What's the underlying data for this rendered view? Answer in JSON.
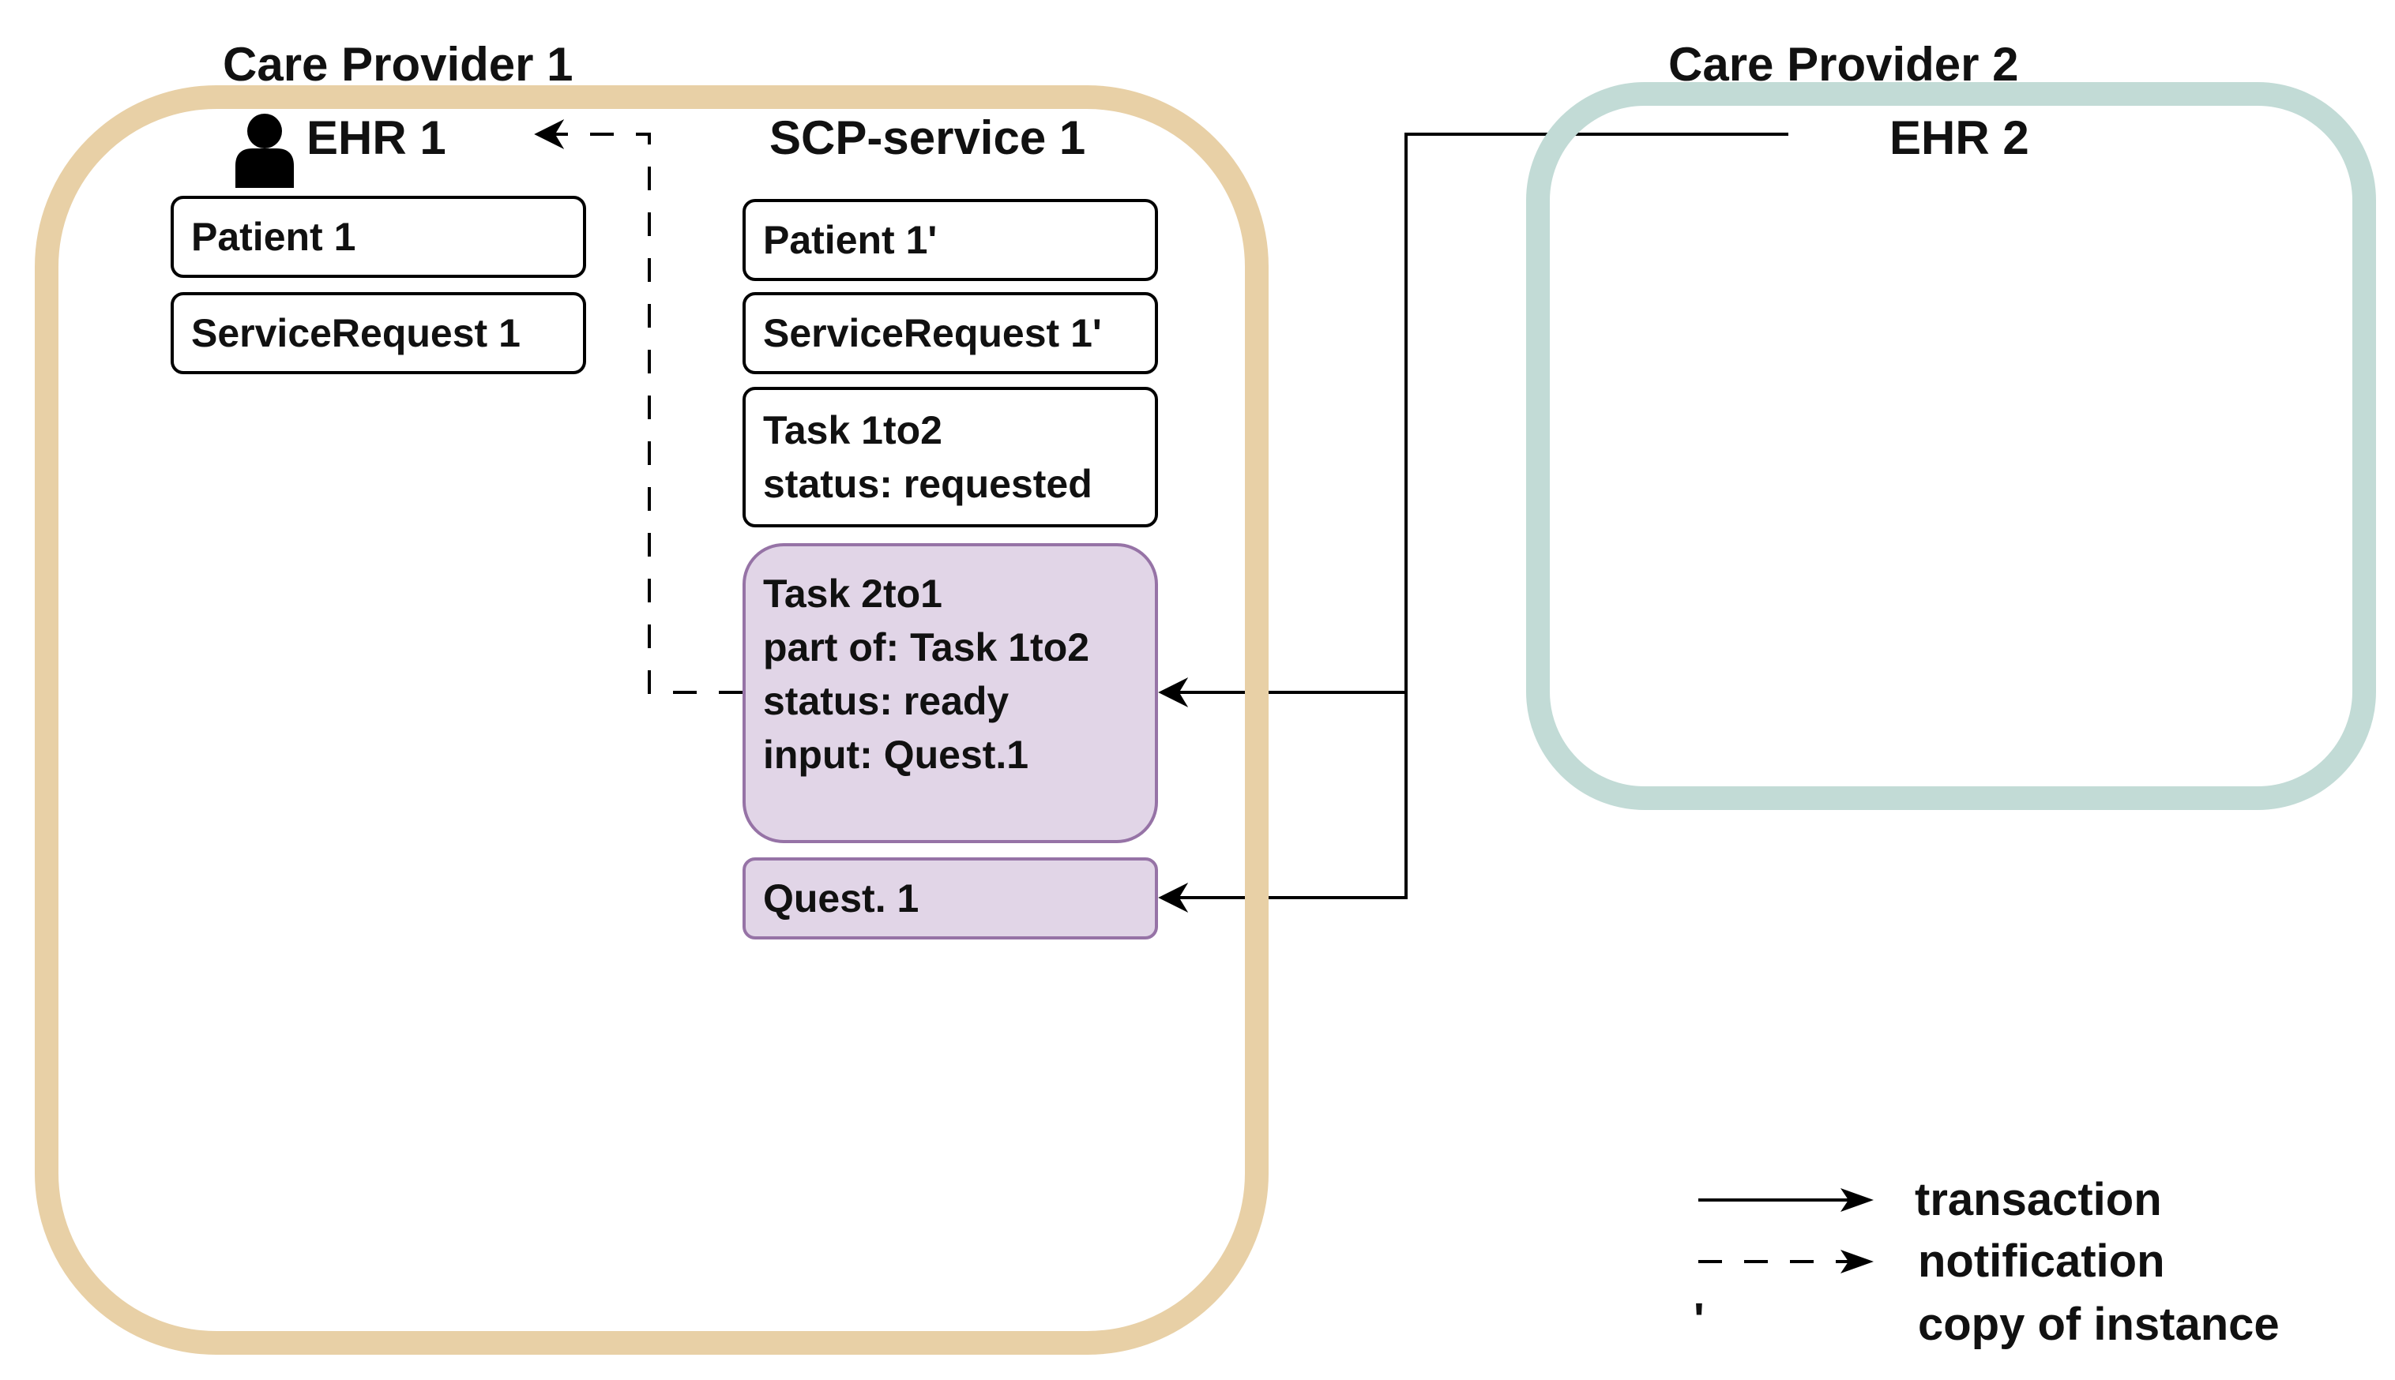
{
  "colors": {
    "provider1_border": "#e8d0a6",
    "provider2_border": "#c2dbd6",
    "highlight_fill": "#e1d5e7",
    "highlight_border": "#9673a6"
  },
  "provider1": {
    "title": "Care Provider 1",
    "ehr": {
      "title": "EHR 1",
      "icon": "user-icon"
    },
    "ehr_resources": [
      {
        "lines": [
          "Patient 1"
        ]
      },
      {
        "lines": [
          "ServiceRequest 1"
        ]
      }
    ],
    "scp": {
      "title": "SCP-service 1"
    },
    "scp_resources": [
      {
        "lines": [
          "Patient 1'"
        ]
      },
      {
        "lines": [
          "ServiceRequest 1'"
        ]
      },
      {
        "lines": [
          "Task 1to2",
          "status: requested"
        ]
      },
      {
        "lines": [
          "Task 2to1",
          "part of: Task 1to2",
          "status: ready",
          "input: Quest.1"
        ]
      },
      {
        "lines": [
          "Quest. 1"
        ]
      }
    ]
  },
  "provider2": {
    "title": "Care Provider 2",
    "ehr": {
      "title": "EHR 2"
    }
  },
  "legend": {
    "transaction": "transaction",
    "notification": "notification",
    "copy_symbol": "'",
    "copy_label": "copy of instance"
  }
}
